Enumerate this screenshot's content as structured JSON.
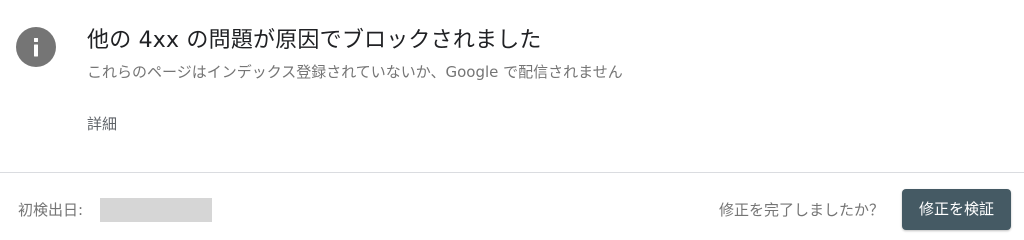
{
  "issue": {
    "icon": "info-icon",
    "title": "他の 4xx の問題が原因でブロックされました",
    "subtitle": "これらのページはインデックス登録されていないか、Google で配信されません",
    "details_link": "詳細"
  },
  "footer": {
    "first_detected_label": "初検出日:",
    "fix_question": "修正を完了しましたか？",
    "validate_button": "修正を検証"
  },
  "colors": {
    "icon_bg": "#757575",
    "button_bg": "#455a64",
    "redaction": "#d6d6d6"
  }
}
